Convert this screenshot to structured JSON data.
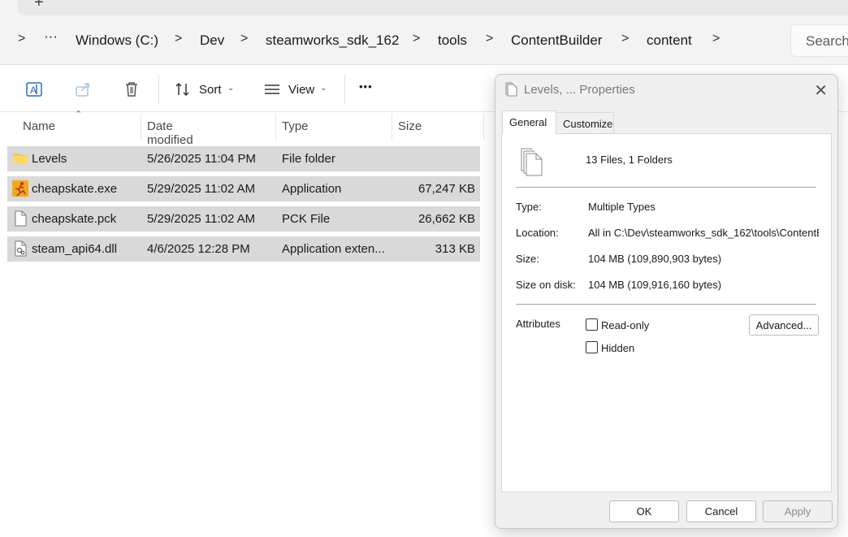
{
  "tabstrip": {
    "new_tab_icon": "+"
  },
  "breadcrumb": {
    "expand_icon": ">",
    "more": "···",
    "items": [
      "Windows (C:)",
      "Dev",
      "steamworks_sdk_162",
      "tools",
      "ContentBuilder",
      "content"
    ],
    "separator": ">"
  },
  "search": {
    "placeholder": "Search"
  },
  "commandbar": {
    "sort_label": "Sort",
    "view_label": "View",
    "more": "•••"
  },
  "columns": {
    "name": "Name",
    "date": "Date modified",
    "type": "Type",
    "size": "Size"
  },
  "files": [
    {
      "name": "Levels",
      "date": "5/26/2025 11:04 PM",
      "type": "File folder",
      "size": "",
      "icon": "folder-icon"
    },
    {
      "name": "cheapskate.exe",
      "date": "5/29/2025 11:02 AM",
      "type": "Application",
      "size": "67,247 KB",
      "icon": "app-icon"
    },
    {
      "name": "cheapskate.pck",
      "date": "5/29/2025 11:02 AM",
      "type": "PCK File",
      "size": "26,662 KB",
      "icon": "file-icon"
    },
    {
      "name": "steam_api64.dll",
      "date": "4/6/2025 12:28 PM",
      "type": "Application exten...",
      "size": "313 KB",
      "icon": "dll-icon"
    }
  ],
  "dialog": {
    "title": "Levels, ... Properties",
    "close": "✕",
    "tabs": {
      "general": "General",
      "customize": "Customize"
    },
    "summary": "13 Files, 1 Folders",
    "type_label": "Type:",
    "type_value": "Multiple Types",
    "location_label": "Location:",
    "location_value": "All in C:\\Dev\\steamworks_sdk_162\\tools\\ContentB",
    "size_label": "Size:",
    "size_value": "104 MB (109,890,903 bytes)",
    "size_on_disk_label": "Size on disk:",
    "size_on_disk_value": "104 MB (109,916,160 bytes)",
    "attributes_label": "Attributes",
    "readonly_label": "Read-only",
    "hidden_label": "Hidden",
    "advanced_label": "Advanced...",
    "ok_label": "OK",
    "cancel_label": "Cancel",
    "apply_label": "Apply"
  }
}
